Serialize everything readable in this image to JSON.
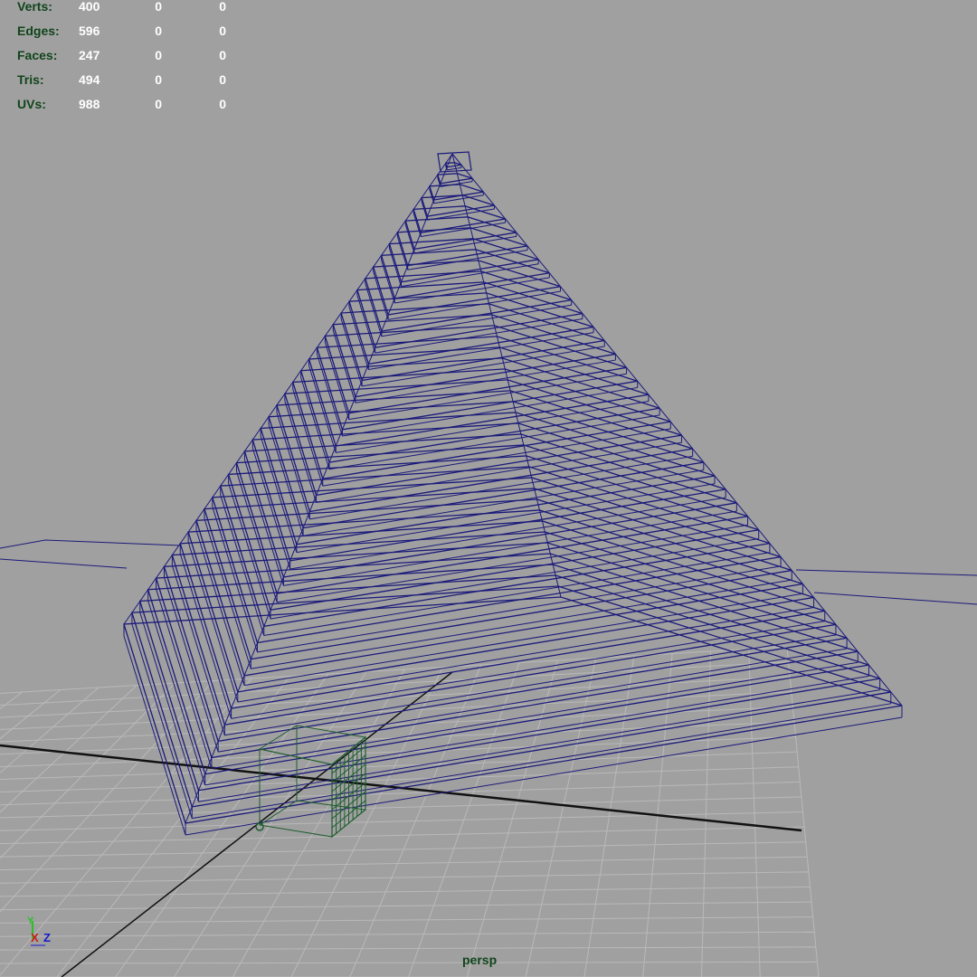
{
  "viewport": {
    "camera_label": "persp",
    "background_color": "#a0a0a0",
    "wire_color": "#1b1a7a",
    "selection_color": "#1d5d2d"
  },
  "hud": {
    "rows": [
      {
        "label": "Verts:",
        "v1": "400",
        "v2": "0",
        "v3": "0"
      },
      {
        "label": "Edges:",
        "v1": "596",
        "v2": "0",
        "v3": "0"
      },
      {
        "label": "Faces:",
        "v1": "247",
        "v2": "0",
        "v3": "0"
      },
      {
        "label": "Tris:",
        "v1": "494",
        "v2": "0",
        "v3": "0"
      },
      {
        "label": "UVs:",
        "v1": "988",
        "v2": "0",
        "v3": "0"
      }
    ]
  },
  "axis_gizmo": {
    "y": "Y",
    "x": "X",
    "z": "Z"
  }
}
